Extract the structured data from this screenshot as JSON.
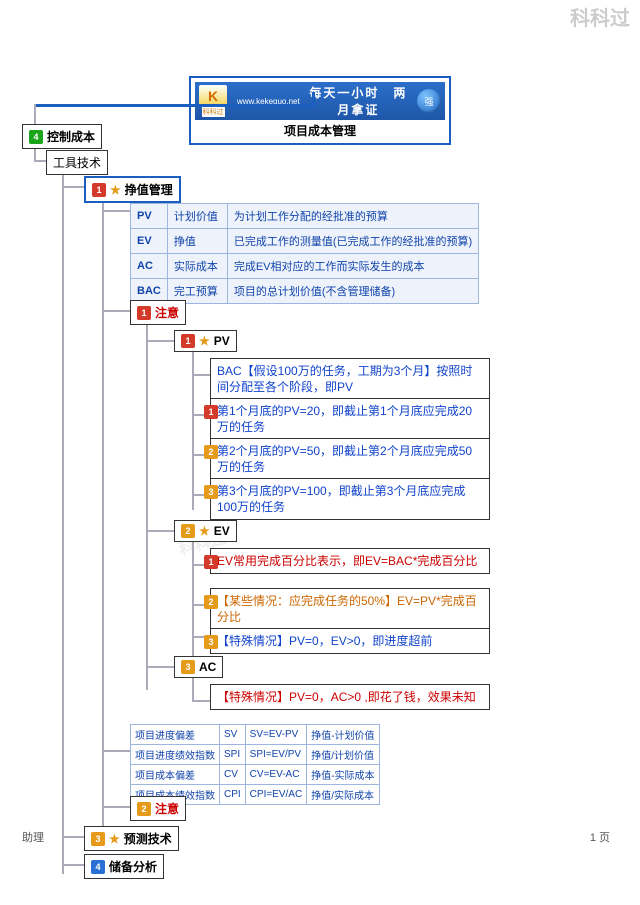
{
  "watermark": "科科过",
  "watermark_mid": "科科过",
  "banner": {
    "logo": "K",
    "logo_sub": "科科过",
    "url": "www.kekeguo.net",
    "slogan": "每天一小时　两月拿证",
    "badge": "强",
    "title": "项目成本管理"
  },
  "nodes": {
    "control_cost": "控制成本",
    "tools": "工具技术",
    "evm": "挣值管理",
    "note": "注意",
    "pv": "PV",
    "ev": "EV",
    "ac": "AC",
    "note2": "注意",
    "forecast": "预测技术",
    "reserve": "储备分析"
  },
  "def_table": [
    {
      "k": "PV",
      "n": "计划价值",
      "d": "为计划工作分配的经批准的预算"
    },
    {
      "k": "EV",
      "n": "挣值",
      "d": "已完成工作的测量值(已完成工作的经批准的预算)"
    },
    {
      "k": "AC",
      "n": "实际成本",
      "d": "完成EV相对应的工作而实际发生的成本"
    },
    {
      "k": "BAC",
      "n": "完工预算",
      "d": "项目的总计划价值(不含管理储备)"
    }
  ],
  "pv_boxes": {
    "intro": "BAC【假设100万的任务，工期为3个月】按照时间分配至各个阶段，即PV",
    "m1": "第1个月底的PV=20，即截止第1个月底应完成20万的任务",
    "m2": "第2个月底的PV=50，即截止第2个月底应完成50万的任务",
    "m3": "第3个月底的PV=100，即截止第3个月底应完成100万的任务"
  },
  "ev_boxes": {
    "e1": "EV常用完成百分比表示，即EV=BAC*完成百分比",
    "e2": "【某些情况：应完成任务的50%】EV=PV*完成百分比",
    "e3": "【特殊情况】PV=0，EV>0，即进度超前"
  },
  "ac_box": "【特殊情况】PV=0，AC>0 ,即花了钱，效果未知",
  "sv_table": [
    [
      "项目进度偏差",
      "SV",
      "SV=EV-PV",
      "挣值-计划价值"
    ],
    [
      "项目进度绩效指数",
      "SPI",
      "SPI=EV/PV",
      "挣值/计划价值"
    ],
    [
      "项目成本偏差",
      "CV",
      "CV=EV-AC",
      "挣值-实际成本"
    ],
    [
      "项目成本绩效指数",
      "CPI",
      "CPI=EV/AC",
      "挣值/实际成本"
    ]
  ],
  "footer": {
    "left": "助理",
    "right": "1 页"
  }
}
